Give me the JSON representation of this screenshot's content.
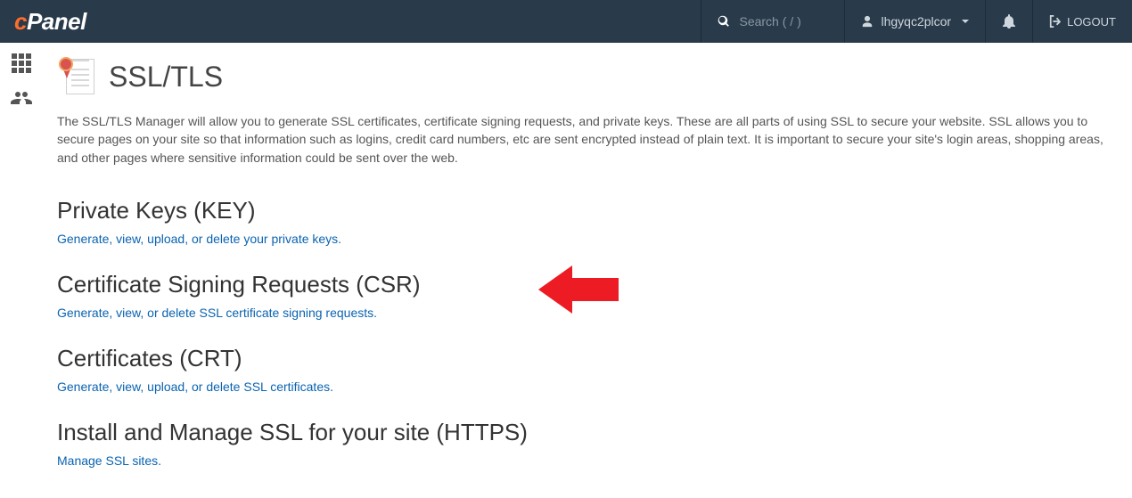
{
  "header": {
    "brand_c": "c",
    "brand_rest": "Panel",
    "search_placeholder": "Search ( / )",
    "username": "lhgyqc2plcor",
    "logout": "LOGOUT"
  },
  "page": {
    "title": "SSL/TLS",
    "intro": "The SSL/TLS Manager will allow you to generate SSL certificates, certificate signing requests, and private keys. These are all parts of using SSL to secure your website. SSL allows you to secure pages on your site so that information such as logins, credit card numbers, etc are sent encrypted instead of plain text. It is important to secure your site's login areas, shopping areas, and other pages where sensitive information could be sent over the web."
  },
  "sections": {
    "key": {
      "title": "Private Keys (KEY)",
      "link": "Generate, view, upload, or delete your private keys."
    },
    "csr": {
      "title": "Certificate Signing Requests (CSR)",
      "link": "Generate, view, or delete SSL certificate signing requests."
    },
    "crt": {
      "title": "Certificates (CRT)",
      "link": "Generate, view, upload, or delete SSL certificates."
    },
    "install": {
      "title": "Install and Manage SSL for your site (HTTPS)",
      "link": "Manage SSL sites."
    }
  }
}
